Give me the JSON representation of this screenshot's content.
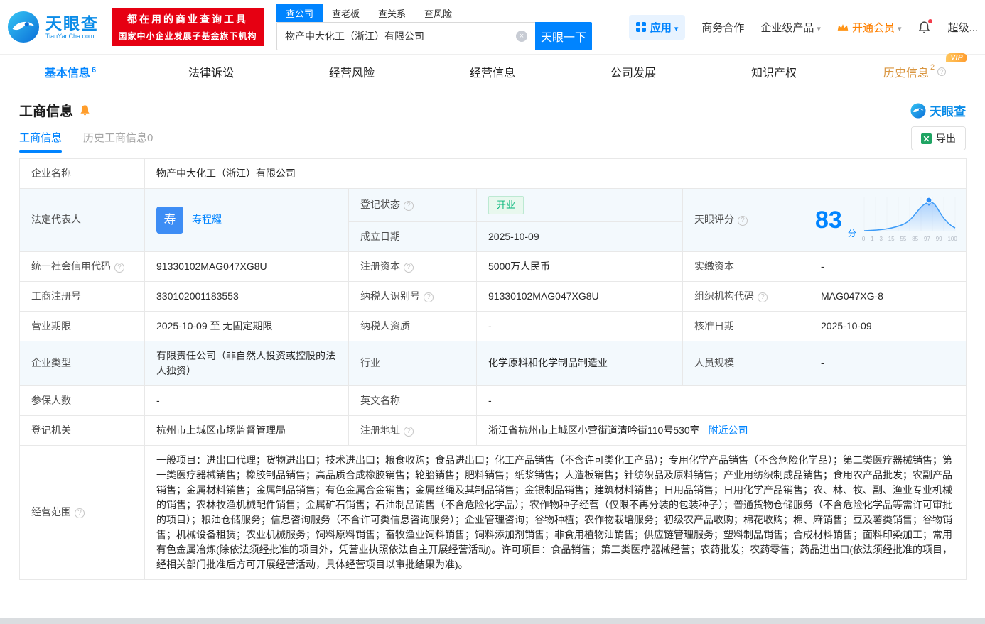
{
  "colors": {
    "brand_blue": "#0084ff",
    "banner_red": "#e60012",
    "vip_orange": "#ff8000",
    "status_green": "#00b578",
    "history_gold": "#d9953f"
  },
  "header": {
    "logo": {
      "title": "天眼查",
      "subtitle": "TianYanCha.com"
    },
    "promo": {
      "line1": "都在用的商业查询工具",
      "line2": "国家中小企业发展子基金旗下机构"
    },
    "search": {
      "tabs": [
        {
          "label": "查公司"
        },
        {
          "label": "查老板"
        },
        {
          "label": "查关系"
        },
        {
          "label": "查风险"
        }
      ],
      "value": "物产中大化工（浙江）有限公司",
      "button": "天眼一下"
    },
    "apps_label": "应用",
    "links": {
      "cooperation": "商务合作",
      "enterprise": "企业级产品",
      "vip": "开通会员",
      "user": "超级..."
    }
  },
  "tabs": {
    "basic": {
      "label": "基本信息",
      "count": "6"
    },
    "legal": {
      "label": "法律诉讼"
    },
    "risk": {
      "label": "经营风险"
    },
    "operation": {
      "label": "经营信息"
    },
    "development": {
      "label": "公司发展"
    },
    "ip": {
      "label": "知识产权"
    },
    "history": {
      "label": "历史信息",
      "count": "2",
      "badge": "VIP"
    }
  },
  "section": {
    "title": "工商信息",
    "watermark": "天眼查",
    "subtabs": {
      "current": "工商信息",
      "history": "历史工商信息0"
    },
    "export_button": "导出"
  },
  "info": {
    "company_name": {
      "label": "企业名称",
      "value": "物产中大化工（浙江）有限公司"
    },
    "legal_rep": {
      "label": "法定代表人",
      "value": "寿程耀",
      "avatar": "寿"
    },
    "reg_status": {
      "label": "登记状态",
      "value": "开业"
    },
    "establish_date": {
      "label": "成立日期",
      "value": "2025-10-09"
    },
    "score_label": {
      "label": "天眼评分"
    },
    "credit_code": {
      "label": "统一社会信用代码",
      "value": "91330102MAG047XG8U"
    },
    "reg_capital": {
      "label": "注册资本",
      "value": "5000万人民币"
    },
    "paid_capital": {
      "label": "实缴资本",
      "value": "-"
    },
    "reg_number": {
      "label": "工商注册号",
      "value": "330102001183553"
    },
    "taxpayer_id": {
      "label": "纳税人识别号",
      "value": "91330102MAG047XG8U"
    },
    "org_code": {
      "label": "组织机构代码",
      "value": "MAG047XG-8"
    },
    "business_term": {
      "label": "营业期限",
      "value": "2025-10-09 至 无固定期限"
    },
    "taxpayer_qualification": {
      "label": "纳税人资质",
      "value": "-"
    },
    "approval_date": {
      "label": "核准日期",
      "value": "2025-10-09"
    },
    "company_type": {
      "label": "企业类型",
      "value": "有限责任公司（非自然人投资或控股的法人独资）"
    },
    "industry": {
      "label": "行业",
      "value": "化学原料和化学制品制造业"
    },
    "staff_size": {
      "label": "人员规模",
      "value": "-"
    },
    "insured_count": {
      "label": "参保人数",
      "value": "-"
    },
    "english_name": {
      "label": "英文名称",
      "value": "-"
    },
    "reg_authority": {
      "label": "登记机关",
      "value": "杭州市上城区市场监督管理局"
    },
    "reg_address": {
      "label": "注册地址",
      "value": "浙江省杭州市上城区小营街道清吟街110号530室",
      "link": "附近公司"
    },
    "business_scope": {
      "label": "经营范围",
      "value": "一般项目：进出口代理；货物进出口；技术进出口；粮食收购；食品进出口；化工产品销售（不含许可类化工产品）；专用化学产品销售（不含危险化学品）；第二类医疗器械销售；第一类医疗器械销售；橡胶制品销售；高品质合成橡胶销售；轮胎销售；肥料销售；纸浆销售；人造板销售；针纺织品及原料销售；产业用纺织制成品销售；食用农产品批发；农副产品销售；金属材料销售；金属制品销售；有色金属合金销售；金属丝绳及其制品销售；金银制品销售；建筑材料销售；日用品销售；日用化学产品销售；农、林、牧、副、渔业专业机械的销售；农林牧渔机械配件销售；金属矿石销售；石油制品销售（不含危险化学品）；农作物种子经营（仅限不再分装的包装种子）；普通货物仓储服务（不含危险化学品等需许可审批的项目）；粮油仓储服务；信息咨询服务（不含许可类信息咨询服务）；企业管理咨询；谷物种植；农作物栽培服务；初级农产品收购；棉花收购；棉、麻销售；豆及薯类销售；谷物销售；机械设备租赁；农业机械服务；饲料原料销售；畜牧渔业饲料销售；饲料添加剂销售；非食用植物油销售；供应链管理服务；塑料制品销售；合成材料销售；面料印染加工；常用有色金属冶炼(除依法须经批准的项目外，凭营业执照依法自主开展经营活动)。许可项目：食品销售；第三类医疗器械经营；农药批发；农药零售；药品进出口(依法须经批准的项目，经相关部门批准后方可开展经营活动，具体经营项目以审批结果为准)。"
    }
  },
  "score_chart": {
    "type": "area",
    "score": "83",
    "unit": "分",
    "x_ticks": [
      "0",
      "1",
      "3",
      "15",
      "55",
      "85",
      "97",
      "99",
      "100"
    ]
  },
  "icons": {
    "search_clear": "circle-x",
    "apps": "grid",
    "vip": "crown",
    "notification": "bell",
    "export": "excel",
    "info": "circled-question",
    "section_bell": "bell",
    "score_marker": "pin"
  }
}
